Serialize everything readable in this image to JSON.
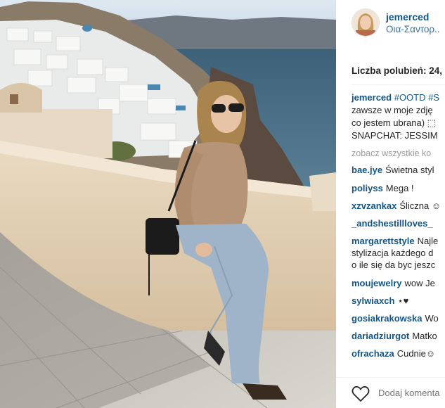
{
  "post": {
    "username": "jemerced",
    "location": "Οια-Σαντορ..",
    "likes_label": "Liczba polubień: 24,",
    "caption_lines": [
      {
        "user": "jemerced",
        "rest": "#OOTD #S"
      },
      {
        "text": "zawsze w moje zdję"
      },
      {
        "text": "co jestem ubrana) ⬚"
      },
      {
        "text": "SNAPCHAT: JESSIM"
      }
    ],
    "see_all": "zobacz wszystkie ko"
  },
  "comments": [
    {
      "user": "bae.jye",
      "text": "Świetna styl"
    },
    {
      "user": "poliyss",
      "text": "Mega !"
    },
    {
      "user": "xzvzankax",
      "text": "Śliczna ☺"
    },
    {
      "user": "_andshestillloves_",
      "text": ""
    },
    {
      "user": "margarettstyle",
      "text": "Najle"
    },
    {
      "user": "",
      "text": "stylizacja każdego d"
    },
    {
      "user": "",
      "text": "o ile się da byc jeszc"
    },
    {
      "user": "moujewelry",
      "text": "wow Je"
    },
    {
      "user": "sylwiaxch",
      "text": "⋆♥"
    },
    {
      "user": "gosiakrakowska",
      "text": "Wo"
    },
    {
      "user": "dariadziurgot",
      "text": "Matko"
    },
    {
      "user": "ofrachaza",
      "text": "Cudnie☺"
    }
  ],
  "footer": {
    "comment_placeholder": "Dodaj komenta"
  },
  "colors": {
    "username": "#125688",
    "location": "#3f729b",
    "text": "#262626",
    "muted": "#999999"
  },
  "icons": {
    "heart": "heart-outline-icon"
  }
}
